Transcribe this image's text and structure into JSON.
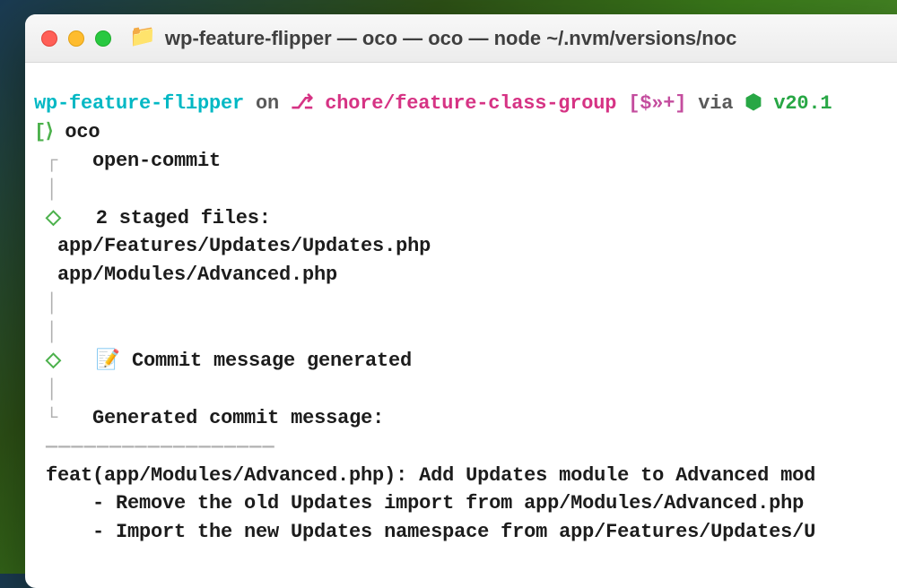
{
  "window": {
    "title": "wp-feature-flipper — oco — oco — node ~/.nvm/versions/noc"
  },
  "prompt": {
    "dir": "wp-feature-flipper",
    "on": " on ",
    "branch_glyph": "⎇",
    "branch": " chore/feature-class-group ",
    "status": "[$»+]",
    "via": " via ",
    "hex": "⬢",
    "node_version": " v20.1",
    "open_bracket": "[",
    "close_bracket": "⟩",
    "command": " oco"
  },
  "output": {
    "tree_top": "┌",
    "tree_pipe": "│",
    "tree_bottom": "└",
    "diamond": "◇",
    "open_commit": "   open-commit",
    "spacer3": "   ",
    "staged_header": "2 staged files:",
    "file1": "  app/Features/Updates/Updates.php",
    "file2": "  app/Modules/Advanced.php",
    "memo_icon": "📝",
    "generated_label": " Commit message generated",
    "generated_msg_label": "Generated commit message:",
    "divider": "——————————————————",
    "commit_line1": " feat(app/Modules/Advanced.php): Add Updates module to Advanced mod",
    "commit_line2": "     - Remove the old Updates import from app/Modules/Advanced.php",
    "commit_line3": "     - Import the new Updates namespace from app/Features/Updates/U"
  }
}
